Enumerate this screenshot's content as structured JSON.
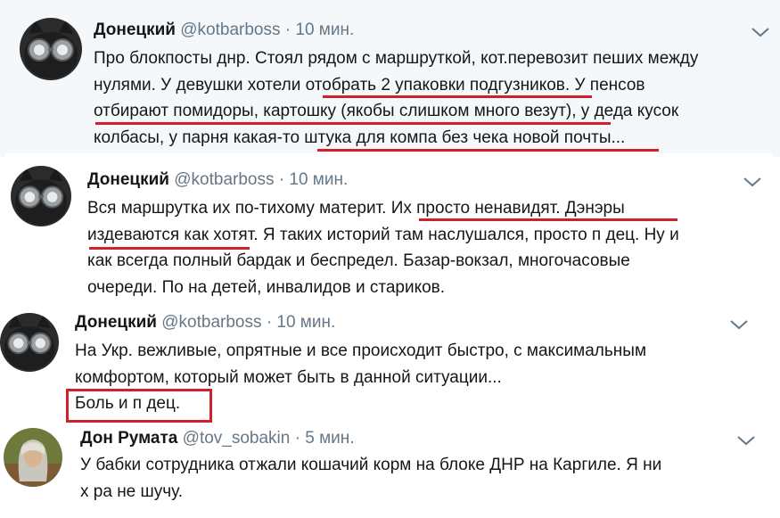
{
  "colors": {
    "highlight_red": "#d0202a",
    "name": "#14171a",
    "meta": "#657786",
    "highlighted_bg": "#f5f8fa"
  },
  "tweets": [
    {
      "author_name": "Донецкий",
      "handle": "@kotbarboss",
      "separator": "·",
      "time": "10 мин.",
      "avatar_icon": "cat-with-goggles-avatar",
      "menu_icon": "chevron-down-icon",
      "lines": [
        "Про блокпосты днр. Стоял рядом с маршруткой, кот.перевозит пеших между",
        "нулями. У девушки хотели отобрать 2 упаковки подгузников. У пенсов",
        "отбирают помидоры, картошку (якобы слишком много везут), у деда кусок",
        "колбасы, у парня какая-то штука для компа без чека новой почты..."
      ]
    },
    {
      "author_name": "Донецкий",
      "handle": "@kotbarboss",
      "separator": "·",
      "time": "10 мин.",
      "avatar_icon": "cat-with-goggles-avatar",
      "menu_icon": "chevron-down-icon",
      "lines": [
        "Вся маршрутка их по-тихому материт. Их просто ненавидят. Дэнэры",
        "издеваются как хотят. Я таких историй там наслушался, просто п    дец. Ну и",
        "как всегда полный бардак и беспредел. Базар-вокзал, многочасовые",
        "очереди. По    на детей, инвалидов и стариков."
      ]
    },
    {
      "author_name": "Донецкий",
      "handle": "@kotbarboss",
      "separator": "·",
      "time": "10 мин.",
      "avatar_icon": "cat-with-goggles-avatar",
      "menu_icon": "chevron-down-icon",
      "lines": [
        "На Укр. вежливые, опрятные и все происходит быстро, с максимальным",
        "комфортом, который может быть в данной ситуации...",
        "Боль и п    дец."
      ]
    },
    {
      "author_name": "Дон Румата",
      "handle": "@tov_sobakin",
      "separator": "·",
      "time": "5 мин.",
      "avatar_icon": "person-with-long-hair-avatar",
      "menu_icon": "chevron-down-icon",
      "lines": [
        "У бабки сотрудника отжали кошачий корм на блоке ДНР на Каргиле. Я ни",
        "х   ра не шучу."
      ]
    }
  ]
}
